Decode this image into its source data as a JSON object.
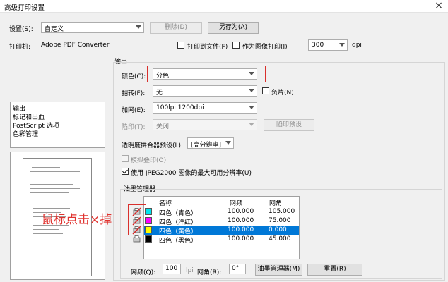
{
  "window": {
    "title": "高级打印设置",
    "close": "×"
  },
  "settings": {
    "label": "设置(S):",
    "value": "自定义",
    "delete_label": "删除(D)",
    "save_as_label": "另存为(A)"
  },
  "printer": {
    "label": "打印机:",
    "value": "Adobe PDF Converter",
    "print_to_file": "打印到文件(F)",
    "print_as_image": "作为图像打印(I)",
    "dpi_value": "300",
    "dpi_unit": "dpi"
  },
  "nav": {
    "items": [
      "输出",
      "标记和出血",
      "PostScript 选项",
      "色彩管理"
    ]
  },
  "output": {
    "group_title": "输出",
    "color_label": "颜色(C):",
    "color_value": "分色",
    "flip_label": "翻转(F):",
    "flip_value": "无",
    "negative_label": "负片(N)",
    "screen_label": "加网(E):",
    "screen_value": "100lpi 1200dpi",
    "trapping_label": "陷印(T):",
    "trapping_value": "关闭",
    "trapping_preset_label": "陷印预设",
    "flattener_label": "透明度拼合器预设(L):",
    "flattener_value": "[高分辨率]",
    "simulate_overprint": "模拟叠印(O)",
    "jpeg2000": "使用 JPEG2000 图像的最大可用分辨率(U)"
  },
  "ink_manager": {
    "group_title": "油墨管理器",
    "columns": {
      "name": "名称",
      "frequency": "网频",
      "angle": "网角"
    },
    "rows": [
      {
        "name": "四色（青色）",
        "freq": "100.000",
        "angle": "105.000",
        "swatch": "#00e5ee",
        "selected": false
      },
      {
        "name": "四色（洋红）",
        "freq": "100.000",
        "angle": "75.000",
        "swatch": "#ff00ff",
        "selected": false
      },
      {
        "name": "四色（黄色）",
        "freq": "100.000",
        "angle": "0.000",
        "swatch": "#ffff00",
        "selected": true
      },
      {
        "name": "四色（黑色）",
        "freq": "100.000",
        "angle": "45.000",
        "swatch": "#000000",
        "selected": false
      }
    ],
    "freq_label": "网频(Q):",
    "freq_value": "100",
    "freq_unit": "lpi",
    "angle_label": "网角(R):",
    "angle_value": "0°",
    "ink_manager_button": "油墨管理器(M)",
    "reset_button": "重置(R)"
  },
  "annotation": {
    "text": "鼠标点击×掉",
    "color": "#e0322e"
  },
  "colors": {
    "highlight": "#0078d7",
    "annotation_red": "#d9302c"
  }
}
